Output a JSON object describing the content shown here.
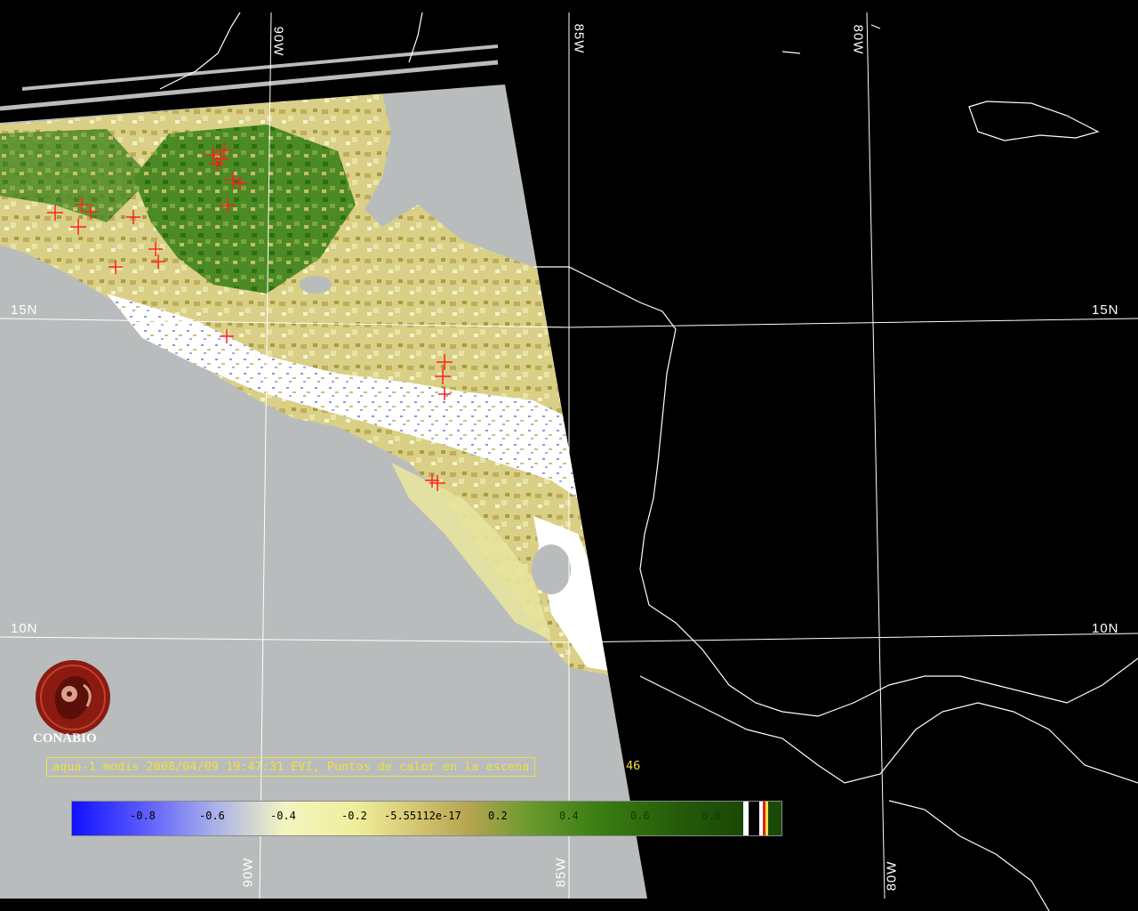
{
  "map": {
    "projection_grid": {
      "lon_top": [
        "90W",
        "85W",
        "80W"
      ],
      "lon_bottom": [
        "90W",
        "85W",
        "80W"
      ],
      "lat_left": [
        "15N",
        "10N"
      ],
      "lat_right": [
        "15N",
        "10N"
      ]
    },
    "colors": {
      "grid": "#ffffff",
      "no_data": "#b8bcbd",
      "background": "#000000",
      "fire_marker": "#ff2020",
      "caption": "#f0e040"
    },
    "fire_markers_visible": 46
  },
  "logo": {
    "text": "CONABIO",
    "icon": "conabio-macaw-logo"
  },
  "caption": {
    "text": "aqua-1 modis 2008/04/09 19:47:31 EVI, Puntos de calor en la escena",
    "count": "46"
  },
  "colorbar": {
    "ticks": [
      "-0.8",
      "-0.6",
      "-0.4",
      "-0.2",
      "-5.55112e-17",
      "0.2",
      "0.4",
      "0.6",
      "0.8"
    ]
  }
}
